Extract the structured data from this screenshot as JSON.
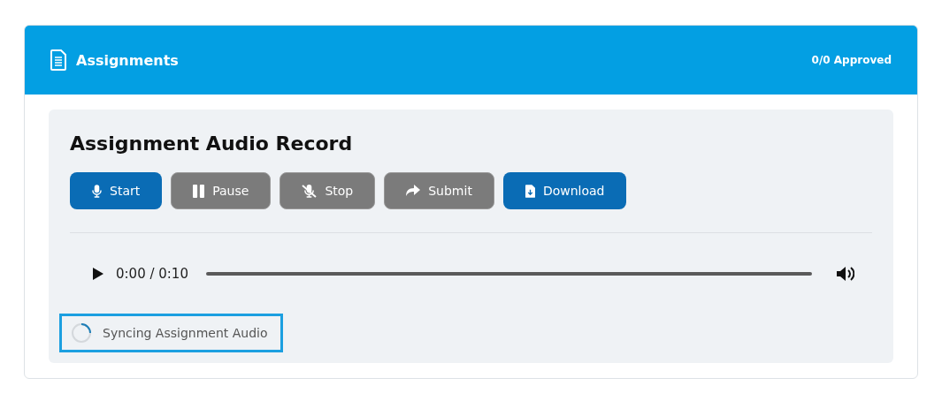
{
  "header": {
    "title": "Assignments",
    "status": "0/0 Approved"
  },
  "recorder": {
    "title": "Assignment Audio Record",
    "buttons": [
      {
        "label": "Start",
        "kind": "mic",
        "disabled": false
      },
      {
        "label": "Pause",
        "kind": "pause",
        "disabled": true
      },
      {
        "label": "Stop",
        "kind": "mic-off",
        "disabled": true
      },
      {
        "label": "Submit",
        "kind": "share",
        "disabled": true
      },
      {
        "label": "Download",
        "kind": "file",
        "disabled": false
      }
    ],
    "player": {
      "time": "0:00 / 0:10"
    },
    "sync": {
      "label": "Syncing Assignment Audio",
      "highlighted": true
    }
  }
}
